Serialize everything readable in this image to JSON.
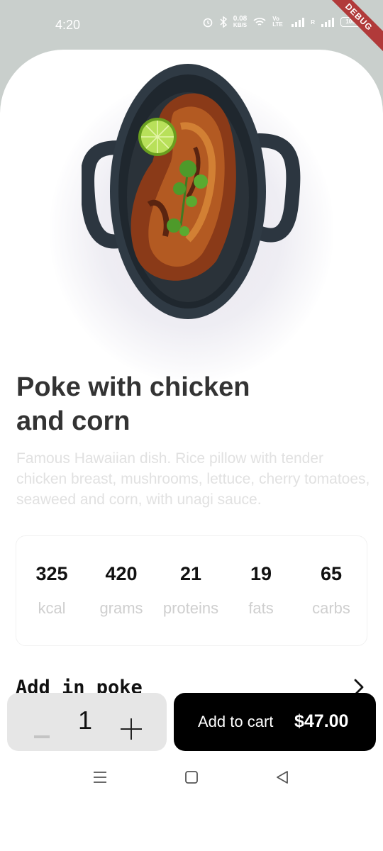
{
  "status_bar": {
    "time": "4:20",
    "net_speed": "0.08",
    "net_unit": "KB/S",
    "volte": "Vo LTE",
    "sim2": "R",
    "battery": "100"
  },
  "debug_banner": "DEBUG",
  "product": {
    "title": "Poke with chicken and corn",
    "description": "Famous Hawaiian dish. Rice pillow with tender chicken breast, mushrooms, lettuce, cherry tomatoes, seaweed and corn, with unagi sauce."
  },
  "nutrition": [
    {
      "value": "325",
      "unit": "kcal"
    },
    {
      "value": "420",
      "unit": "grams"
    },
    {
      "value": "21",
      "unit": "proteins"
    },
    {
      "value": "19",
      "unit": "fats"
    },
    {
      "value": "65",
      "unit": "carbs"
    }
  ],
  "add_in": {
    "label": "Add in poke",
    "icon": "chevron-right-icon"
  },
  "quantity": {
    "value": "1",
    "minus_icon": "minus-icon",
    "plus_icon": "plus-icon"
  },
  "cart": {
    "label": "Add to cart",
    "price": "$47.00"
  },
  "nav": {
    "menu_icon": "menu-icon",
    "home_icon": "home-square-icon",
    "back_icon": "back-triangle-icon"
  },
  "colors": {
    "title": "#333333",
    "description": "#e1e1e1",
    "button_bg": "#000000",
    "quantity_bg": "#e6e6e6",
    "status_bar_bg": "#c9cfcc"
  }
}
